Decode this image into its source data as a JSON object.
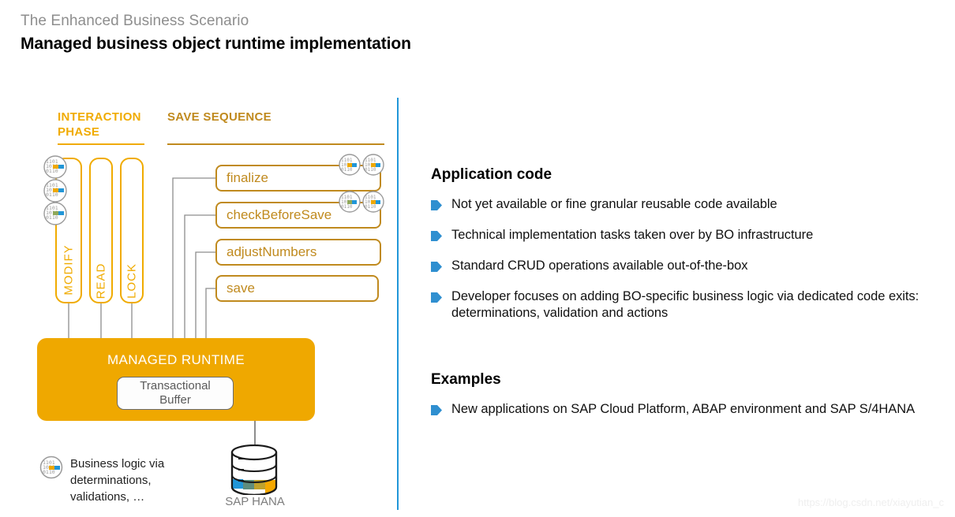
{
  "header": {
    "eyebrow": "The Enhanced Business Scenario",
    "title": "Managed business object runtime implementation"
  },
  "diagram": {
    "columns": [
      {
        "label": "INTERACTION PHASE",
        "color": "#F0AB00"
      },
      {
        "label": "SAVE SEQUENCE",
        "color": "#C08A1E"
      }
    ],
    "interaction_phases": [
      {
        "label": "MODIFY",
        "icons": 3
      },
      {
        "label": "READ",
        "icons": 0
      },
      {
        "label": "LOCK",
        "icons": 0
      }
    ],
    "save_sequence": [
      {
        "label": "finalize",
        "icons": 2
      },
      {
        "label": "checkBeforeSave",
        "icons": 2
      },
      {
        "label": "adjustNumbers",
        "icons": 0
      },
      {
        "label": "save",
        "icons": 0
      }
    ],
    "runtime": {
      "label": "MANAGED RUNTIME",
      "buffer_line1": "Transactional",
      "buffer_line2": "Buffer",
      "color": "#EFA800"
    },
    "database": {
      "label": "SAP HANA"
    },
    "legend": {
      "text": "Business logic via determinations, validations, …",
      "icon": "code-circle-icon"
    }
  },
  "right_panel": {
    "sections": [
      {
        "title": "Application code",
        "bullets": [
          "Not yet available or fine granular reusable code available",
          "Technical implementation tasks taken over by BO infrastructure",
          "Standard CRUD operations available out-of-the-box",
          "Developer focuses on adding BO-specific business logic via dedicated code exits: determinations, validation and actions"
        ]
      },
      {
        "title": "Examples",
        "bullets": [
          "New applications on SAP Cloud Platform, ABAP environment and SAP S/4HANA"
        ]
      }
    ],
    "bullet_color": "#2F8FD0"
  },
  "watermark": "https://blog.csdn.net/xiayutian_c"
}
